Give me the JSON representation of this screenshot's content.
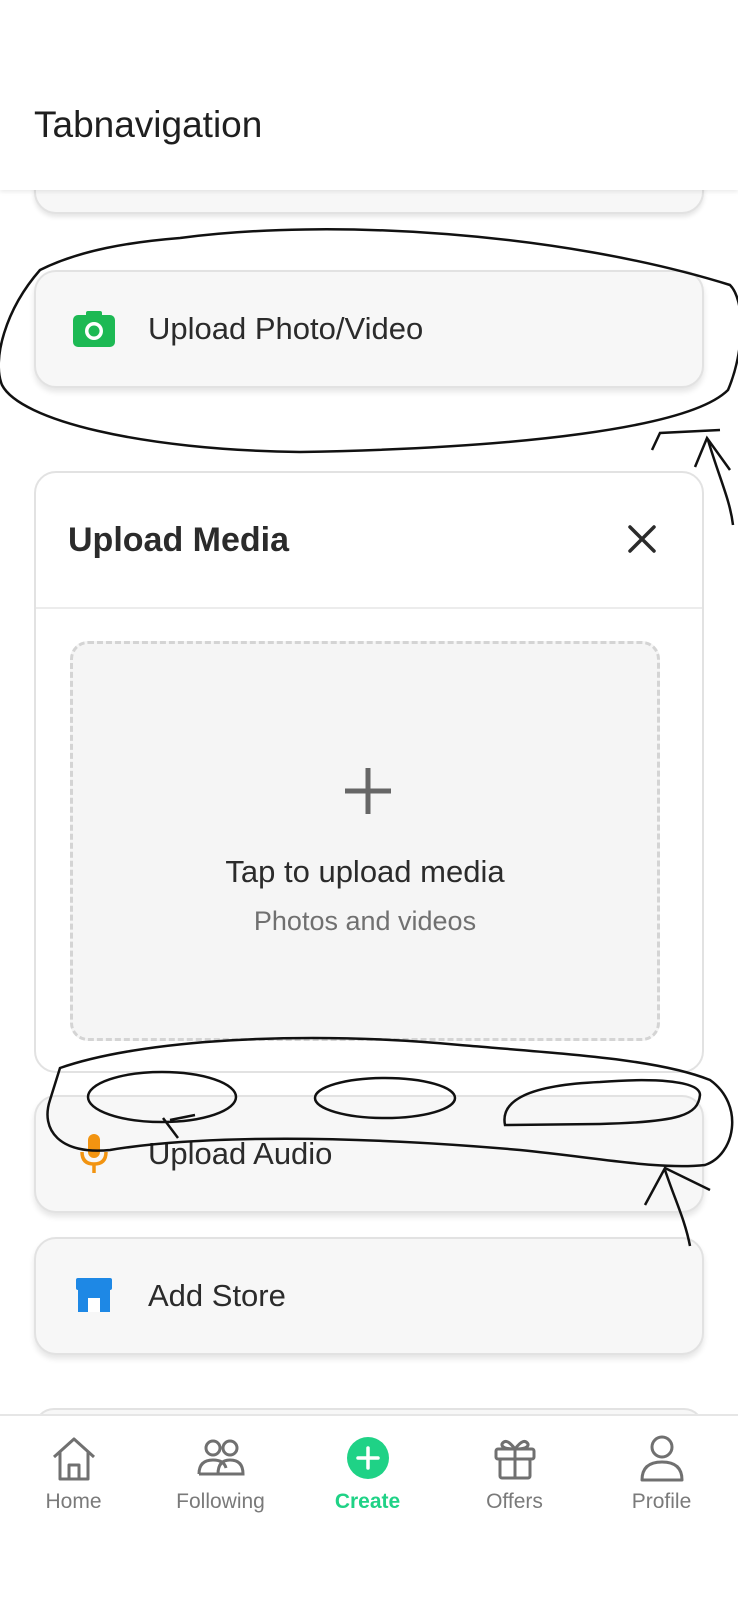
{
  "header": {
    "title": "Tabnavigation"
  },
  "actions": {
    "upload_photo_video": {
      "label": "Upload Photo/Video",
      "icon": "camera-icon",
      "color": "#1db954"
    },
    "upload_audio": {
      "label": "Upload Audio",
      "icon": "microphone-icon",
      "color": "#f29411"
    },
    "add_store": {
      "label": "Add Store",
      "icon": "store-icon",
      "color": "#1e88e5"
    }
  },
  "upload_panel": {
    "title": "Upload Media",
    "close_icon": "close-icon",
    "dropzone": {
      "title": "Tap to upload media",
      "subtitle": "Photos and videos",
      "icon": "plus-icon"
    }
  },
  "tabs": [
    {
      "label": "Home",
      "icon": "home-icon",
      "active": false
    },
    {
      "label": "Following",
      "icon": "people-icon",
      "active": false
    },
    {
      "label": "Create",
      "icon": "add-circle-icon",
      "active": true
    },
    {
      "label": "Offers",
      "icon": "gift-icon",
      "active": false
    },
    {
      "label": "Profile",
      "icon": "person-icon",
      "active": false
    }
  ],
  "colors": {
    "accent": "#1fd286",
    "inactive_tab": "#7a7a7a"
  }
}
